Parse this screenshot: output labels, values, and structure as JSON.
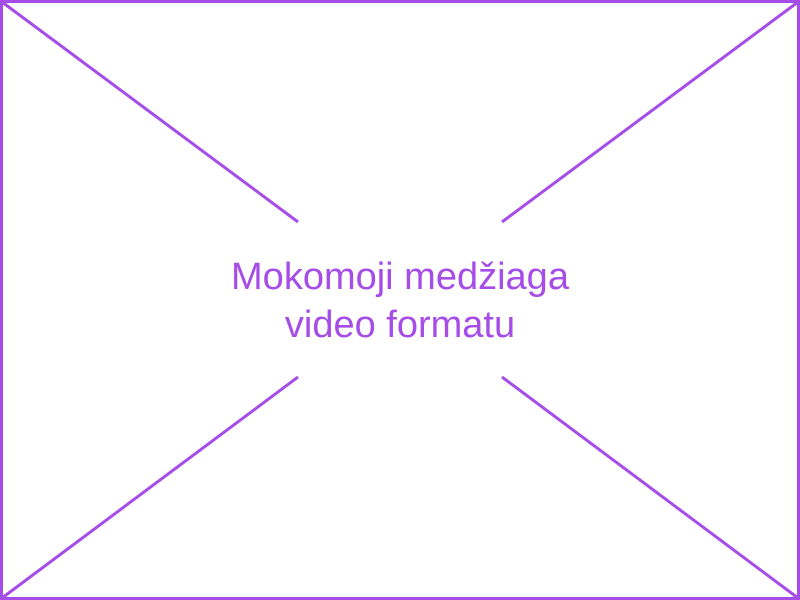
{
  "placeholder": {
    "line1": "Mokomoji medžiaga",
    "line2": "video formatu",
    "accent_color": "#a64de8",
    "background_color": "#ffffff"
  }
}
